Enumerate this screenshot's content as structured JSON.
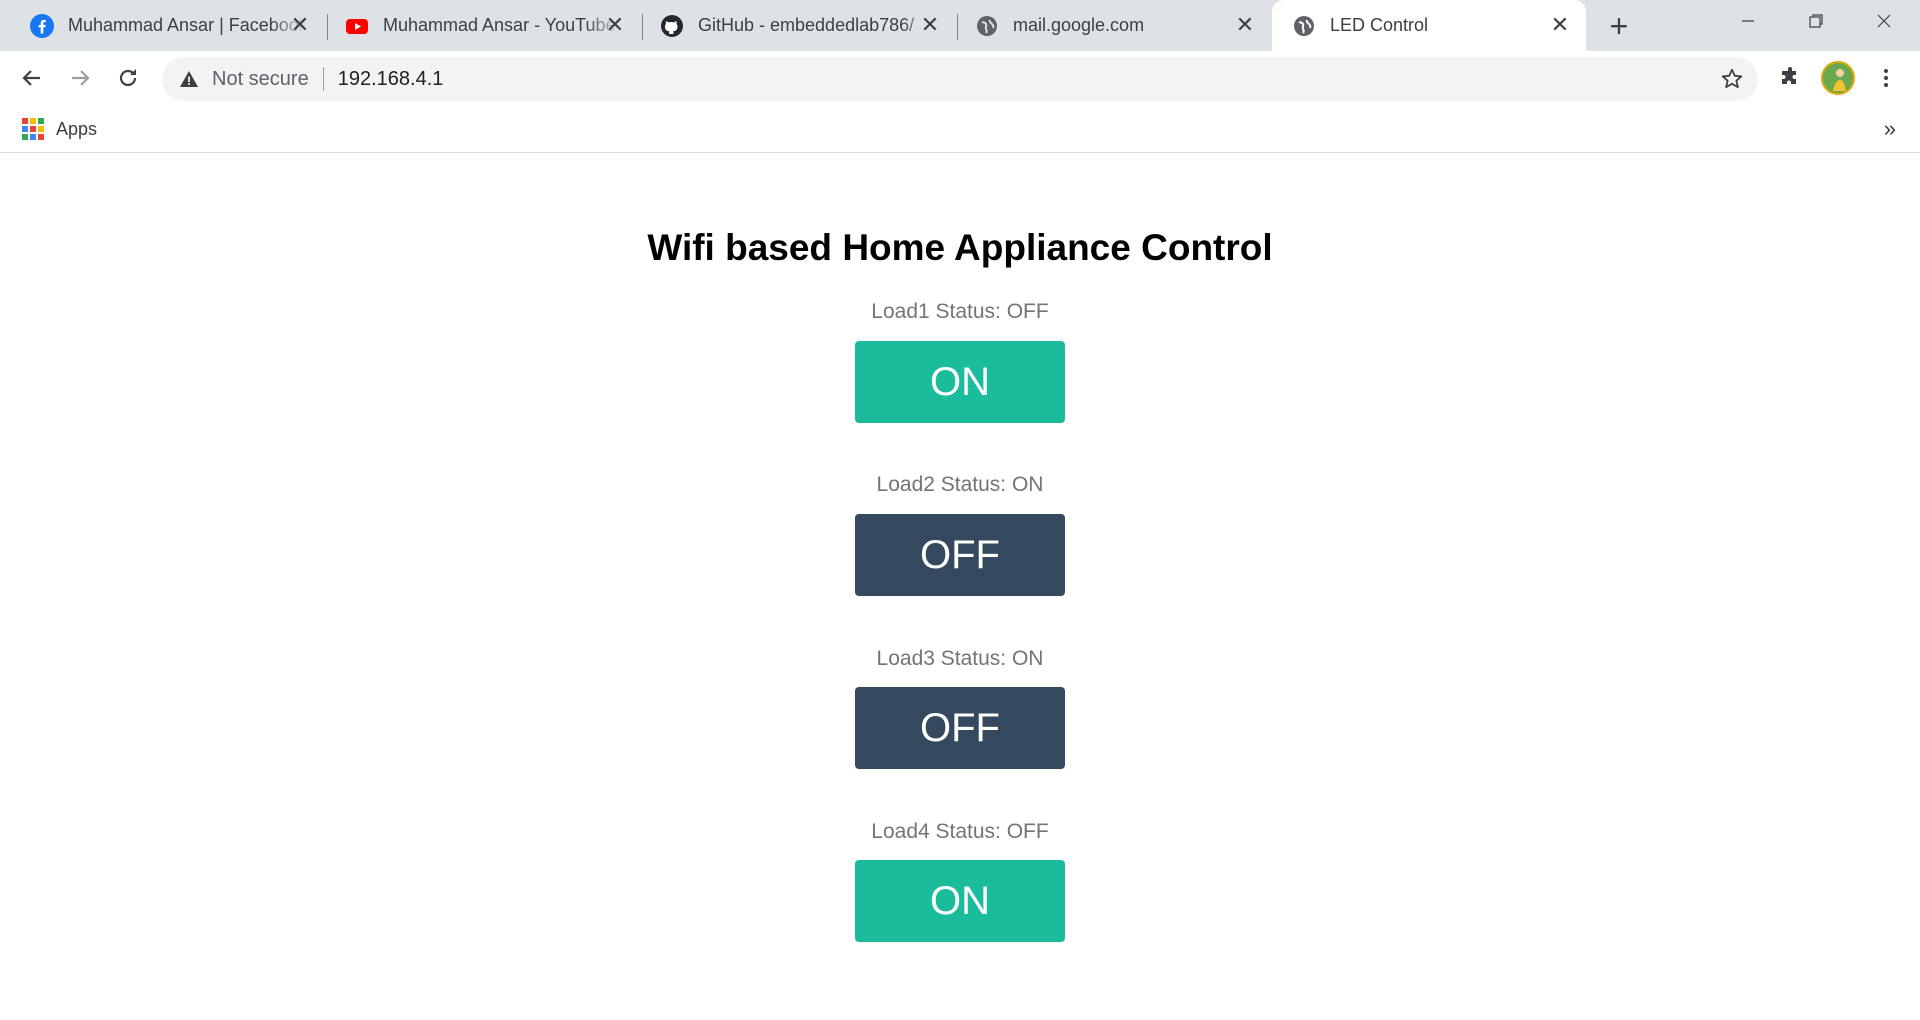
{
  "browser": {
    "tabs": [
      {
        "title": "Muhammad Ansar | Facebook",
        "icon": "facebook-icon",
        "active": false
      },
      {
        "title": "Muhammad Ansar - YouTube",
        "icon": "youtube-icon",
        "active": false
      },
      {
        "title": "GitHub - embeddedlab786/",
        "icon": "github-icon",
        "active": false
      },
      {
        "title": "mail.google.com",
        "icon": "globe-icon",
        "active": false
      },
      {
        "title": "LED Control",
        "icon": "globe-icon",
        "active": true
      }
    ],
    "security_label": "Not secure",
    "url": "192.168.4.1",
    "bookmarks": {
      "apps_label": "Apps",
      "overflow": "»"
    }
  },
  "page": {
    "title": "Wifi based Home Appliance Control",
    "loads": [
      {
        "status": "Load1 Status: OFF",
        "button_label": "ON",
        "button_color": "#1abc9c"
      },
      {
        "status": "Load2 Status: ON",
        "button_label": "OFF",
        "button_color": "#34495e"
      },
      {
        "status": "Load3 Status: ON",
        "button_label": "OFF",
        "button_color": "#34495e"
      },
      {
        "status": "Load4 Status: OFF",
        "button_label": "ON",
        "button_color": "#1abc9c"
      }
    ]
  },
  "colors": {
    "on_button": "#1abc9c",
    "off_button": "#34495e",
    "tabstrip": "#dee1e6"
  }
}
